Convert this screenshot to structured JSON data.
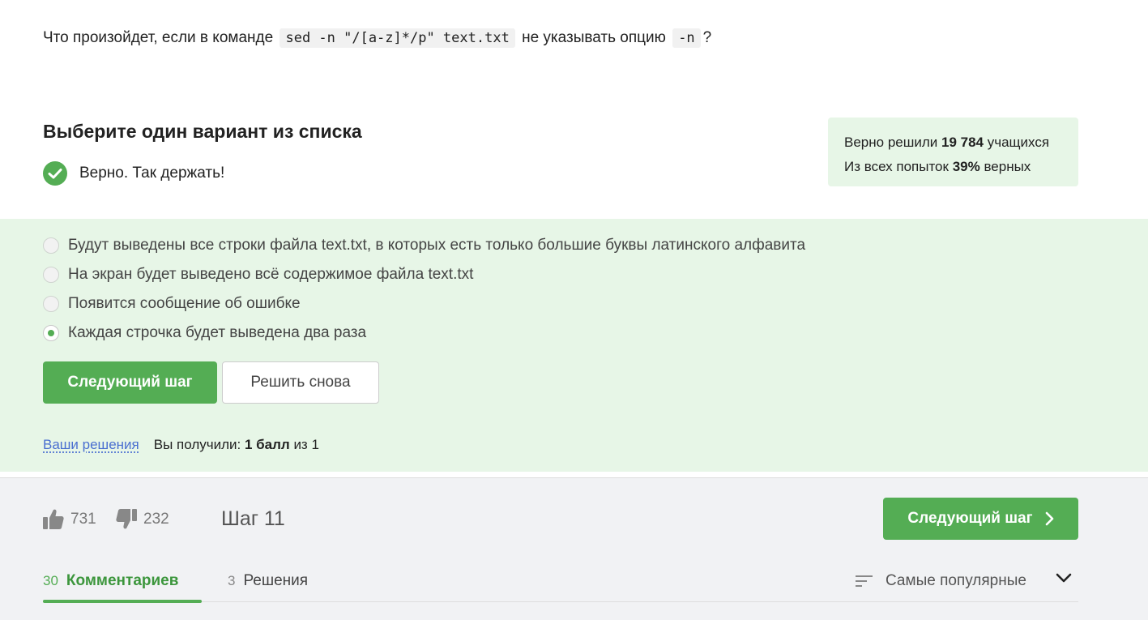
{
  "question": {
    "prefix": "Что произойдет, если в команде",
    "command": "sed -n \"/[a-z]*/p\" text.txt",
    "middle": "не указывать опцию",
    "option_code": "-n",
    "suffix": "?"
  },
  "choose_title": "Выберите один вариант из списка",
  "verdict": {
    "icon": "check-circle-icon",
    "text": "Верно. Так держать!"
  },
  "stats": {
    "solved_prefix": "Верно решили",
    "solved_count": "19 784",
    "solved_suffix": "учащихся",
    "attempts_prefix": "Из всех попыток",
    "attempts_percent": "39%",
    "attempts_suffix": "верных"
  },
  "options": [
    {
      "label": "Будут выведены все строки файла text.txt, в которых есть только большие буквы латинского алфавита",
      "selected": false
    },
    {
      "label": "На экран будет выведено всё содержимое файла text.txt",
      "selected": false
    },
    {
      "label": "Появится сообщение об ошибке",
      "selected": false
    },
    {
      "label": "Каждая строчка будет выведена два раза",
      "selected": true
    }
  ],
  "buttons": {
    "next_step": "Следующий шаг",
    "retry": "Решить снова"
  },
  "solutions": {
    "link": "Ваши решения",
    "received_prefix": "Вы получили:",
    "points": "1 балл",
    "of": "из 1"
  },
  "footer": {
    "likes": "731",
    "dislikes": "232",
    "step": "Шаг 11",
    "next_step": "Следующий шаг"
  },
  "tabs": [
    {
      "count": "30",
      "label": "Комментариев",
      "active": true
    },
    {
      "count": "3",
      "label": "Решения",
      "active": false
    }
  ],
  "sort": {
    "icon": "sort-icon",
    "label": "Самые популярные"
  },
  "colors": {
    "accent": "#54ad54",
    "light_green": "#e7f6e7",
    "link": "#4a6fd0"
  }
}
